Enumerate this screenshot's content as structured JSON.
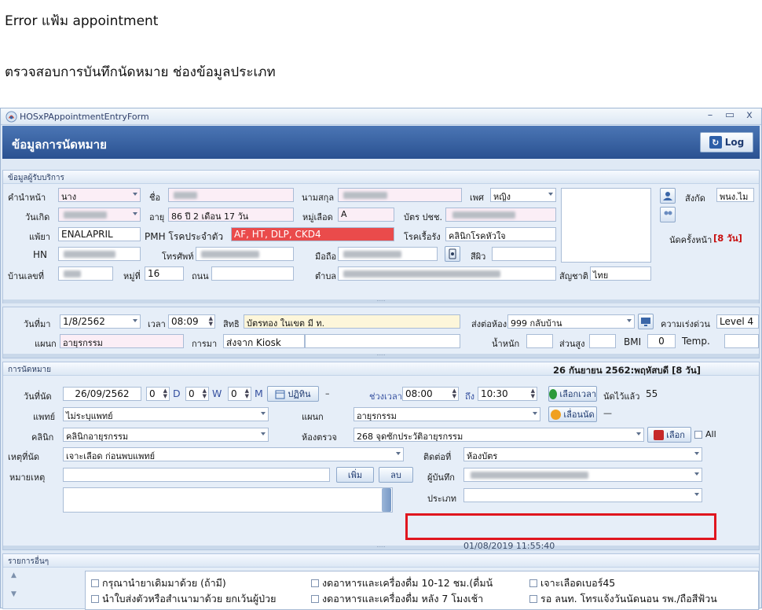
{
  "doc": {
    "title": "Error แฟ้ม appointment",
    "subtitle": "ตรวจสอบการบันทึกนัดหมาย ช่องข้อมูลประเภท"
  },
  "window": {
    "title": "HOSxPAppointmentEntryForm",
    "minimize": "–",
    "maximize": "▭",
    "close": "x"
  },
  "header": {
    "title": "ข้อมูลการนัดหมาย",
    "log_label": "Log"
  },
  "patient": {
    "section_title": "ข้อมูลผู้รับบริการ",
    "prename_label": "คำนำหน้า",
    "prename_value": "นาง",
    "name_label": "ชื่อ",
    "surname_label": "นามสกุล",
    "sex_label": "เพศ",
    "sex_value": "หญิง",
    "birthdate_label": "วันเกิด",
    "age_label": "อายุ",
    "age_value": "86 ปี 2 เดือน 17 วัน",
    "blood_label": "หมู่เลือด",
    "blood_value": "A",
    "cid_label": "บัตร ปชช.",
    "allergy_label": "แพ้ยา",
    "allergy_value": "ENALAPRIL",
    "pmh_label": "PMH โรคประจำตัว",
    "pmh_value": "AF, HT, DLP, CKD4",
    "chronic_label": "โรคเรื้อรัง",
    "chronic_value": "คลินิกโรคหัวใจ",
    "hn_label": "HN",
    "phone_label": "โทรศัพท์",
    "mobile_label": "มือถือ",
    "skin_label": "สีผิว",
    "house_label": "บ้านเลขที่",
    "moo_label": "หมู่ที่",
    "moo_value": "16",
    "road_label": "ถนน",
    "tambon_label": "ตำบล",
    "nation_label": "สัญชาติ",
    "nation_value": "ไทย",
    "affil_label": "สังกัด",
    "affil_value": "พนง.ไม",
    "prev_appt_label": "นัดครั้งหน้า",
    "prev_appt_value": "[8 วัน]"
  },
  "visit": {
    "date_label": "วันที่มา",
    "date_value": "1/8/2562",
    "time_label": "เวลา",
    "time_value": "08:09",
    "right_label": "สิทธิ",
    "right_value": "บัตรทอง ในเขต มี ท.",
    "send_label": "ส่งต่อห้อง",
    "send_value": "999 กลับบ้าน",
    "urgency_label": "ความเร่งด่วน",
    "urgency_value": "Level 4",
    "dept_label": "แผนก",
    "dept_value": "อายุรกรรม",
    "from_label": "การมา",
    "from_value": "ส่งจาก Kiosk",
    "weight_label": "น้ำหนัก",
    "height_label": "ส่วนสูง",
    "bmi_label": "BMI",
    "bmi_value": "0",
    "temp_label": "Temp."
  },
  "appointment": {
    "section_title": "การนัดหมาย",
    "summary": "26 กันยายน 2562:พฤหัสบดี  [8 วัน]",
    "date_label": "วันที่นัด",
    "date_value": "26/09/2562",
    "d_value": "0",
    "d_unit": "D",
    "w_value": "0",
    "w_unit": "W",
    "m_value": "0",
    "m_unit": "M",
    "calendar_btn": "ปฏิทิน",
    "dash": "–",
    "period_label": "ช่วงเวลา",
    "time_from": "08:00",
    "to_label": "ถึง",
    "time_to": "10:30",
    "choose_time_btn": "เลือกเวลา",
    "booked_label": "นัดไว้แล้ว",
    "booked_value": "55",
    "doctor_label": "แพทย์",
    "doctor_value": "ไม่ระบุแพทย์",
    "dept_label": "แผนก",
    "dept_value": "อายุรกรรม",
    "postpone_btn": "เลื่อนนัด",
    "postpone_dash": "—",
    "clinic_label": "คลินิก",
    "clinic_value": "คลินิกอายุรกรรม",
    "room_label": "ห้องตรวจ",
    "room_value": "268 จุดซักประวัติอายุรกรรม",
    "select_btn": "เลือก",
    "all_label": "All",
    "cause_label": "เหตุที่นัด",
    "cause_value": "เจาะเลือด ก่อนพบแพทย์",
    "contact_label": "ติดต่อที่",
    "contact_value": "ห้องบัตร",
    "note_label": "หมายเหตุ",
    "add_btn": "เพิ่ม",
    "del_btn": "ลบ",
    "recorder_label": "ผู้บันทึก",
    "type_label": "ประเภท",
    "type_value": "",
    "record_datetime": "01/08/2019 11:55:40"
  },
  "others": {
    "section_title": "รายการอื่นๆ",
    "items": [
      "กรุณานำยาเดิมมาด้วย (ถ้ามี)",
      "งดอาหารและเครื่องดื่ม 10-12 ชม.(ดื่มน้",
      "เจาะเลือดเบอร์45",
      "นำใบส่งตัวหรือสำเนามาด้วย ยกเว้นผู้ป่วย",
      "งดอาหารและเครื่องดื่ม หลัง 7 โมงเช้า",
      "รอ ลนท. โทรแจ้งวันนัดนอน รพ./ถือสีฟ้วน"
    ]
  },
  "colors": {
    "header_bg": "#2a5191",
    "pmh_bg": "#ea4b4b",
    "highlight": "#e0161f",
    "summary_red": "#c81010"
  }
}
